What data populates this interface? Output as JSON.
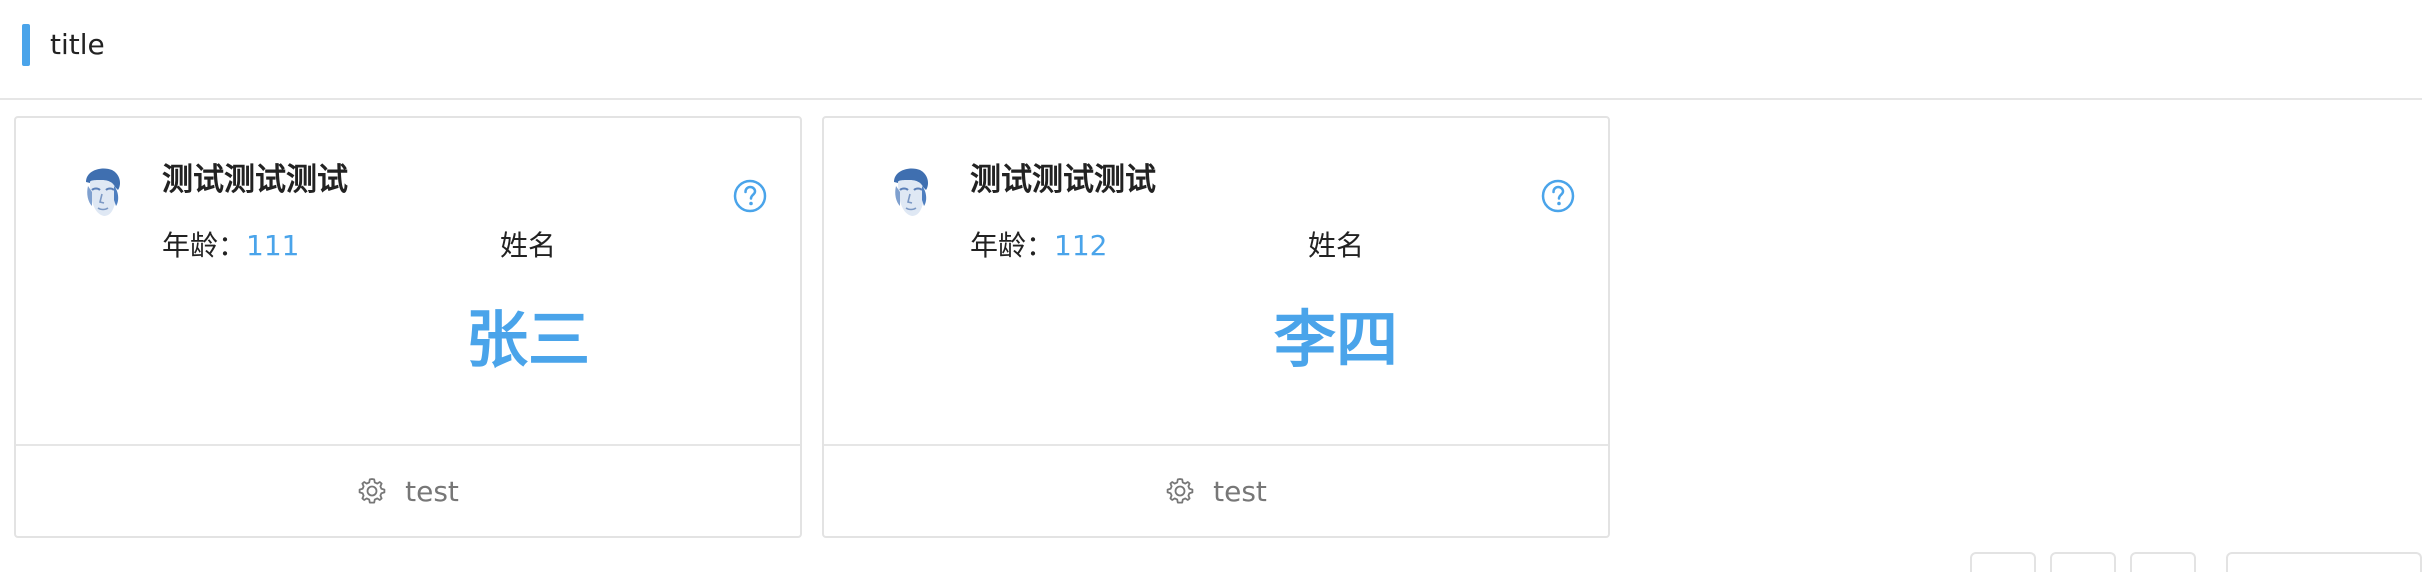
{
  "header": {
    "title": "title"
  },
  "colors": {
    "accent": "#4aa4ea",
    "border": "#e3e3e3"
  },
  "cards": [
    {
      "title": "测试测试测试",
      "age_label": "年龄：",
      "age_value": "111",
      "name_label": "姓名",
      "name_value": "张三",
      "footer_icon": "gear-icon",
      "footer_label": "test",
      "help_icon": "question-circle-icon"
    },
    {
      "title": "测试测试测试",
      "age_label": "年龄：",
      "age_value": "112",
      "name_label": "姓名",
      "name_value": "李四",
      "footer_icon": "gear-icon",
      "footer_label": "test",
      "help_icon": "question-circle-icon"
    }
  ]
}
